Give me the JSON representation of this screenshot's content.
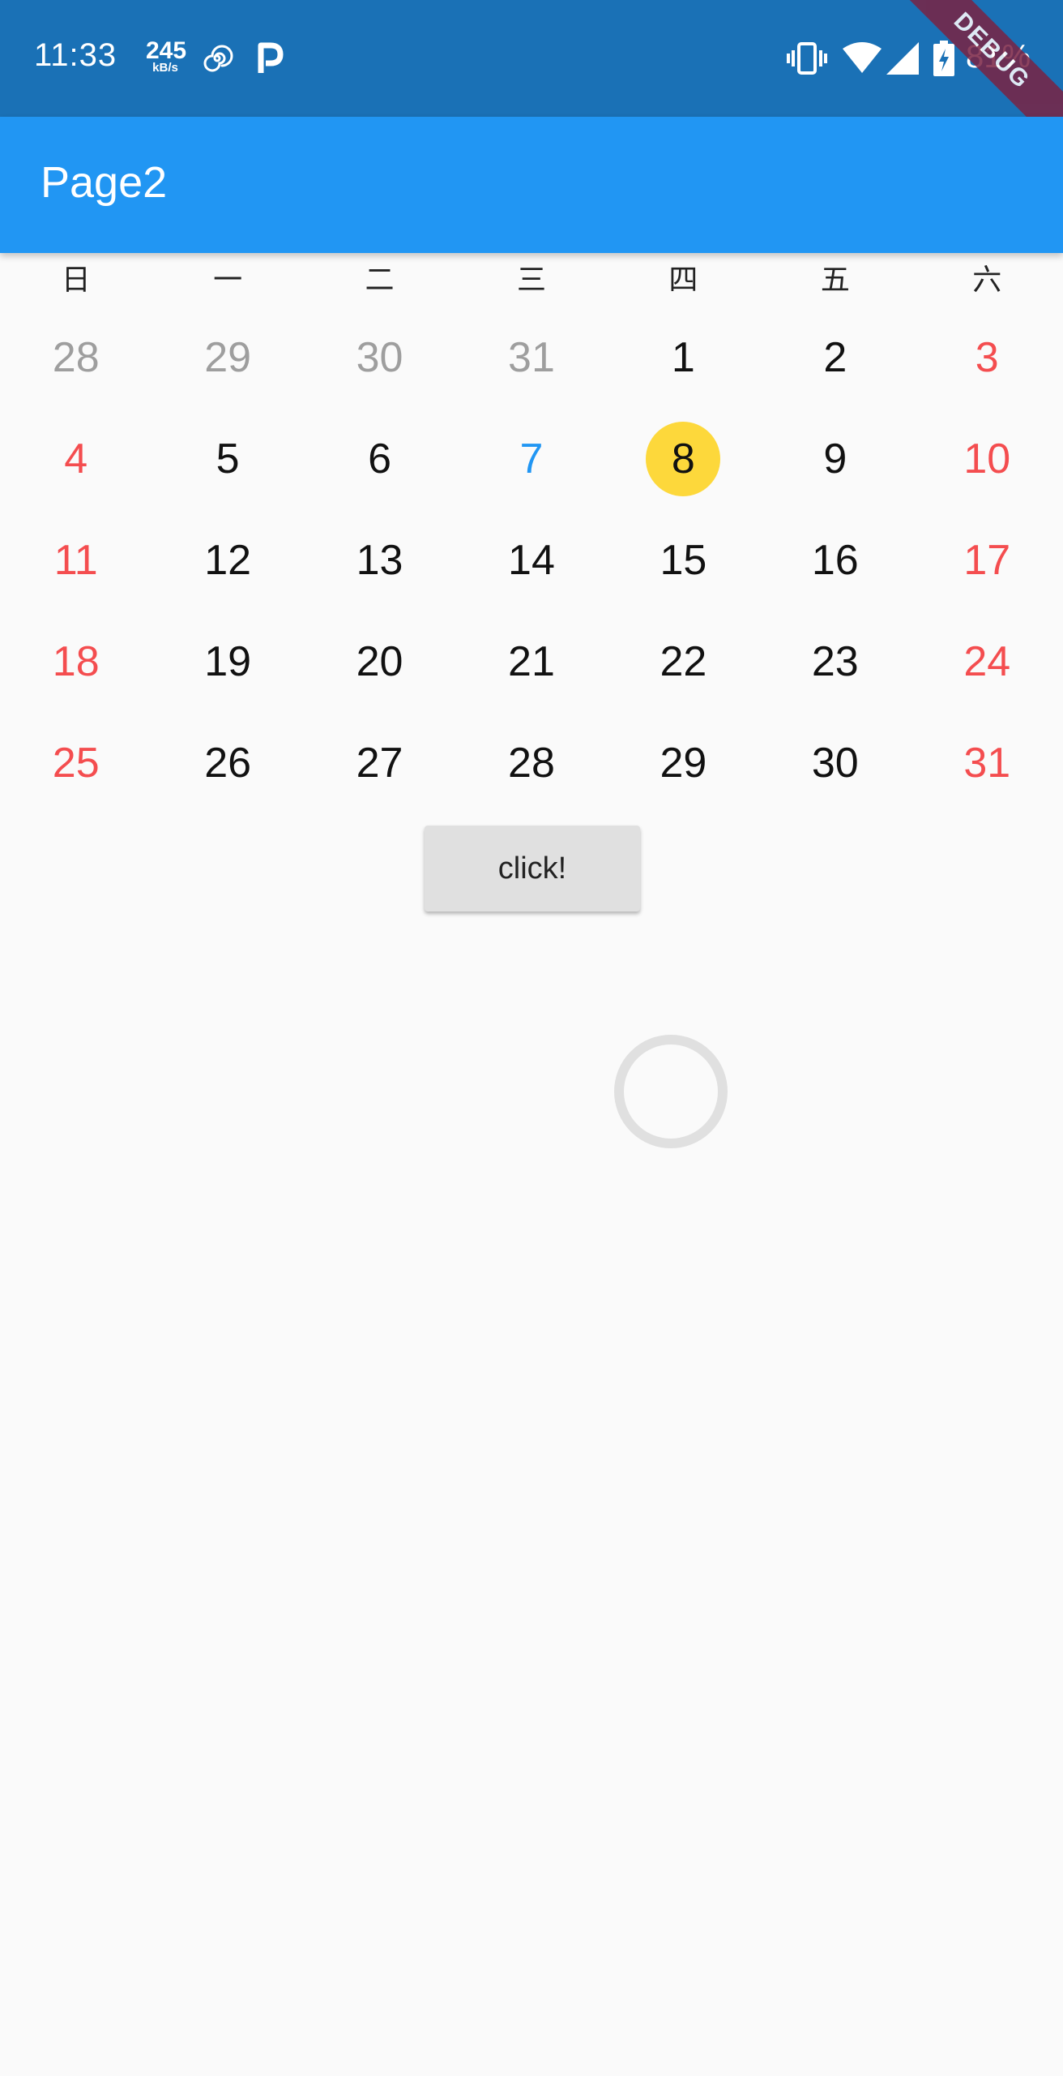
{
  "status_bar": {
    "time": "11:33",
    "net_speed": "245",
    "net_speed_unit": "kB/s",
    "battery_percent": "81%",
    "icons": [
      "spiral-icon",
      "p-app-icon",
      "vibrate-icon",
      "wifi-icon",
      "cell-signal-icon",
      "battery-charging-icon"
    ]
  },
  "debug_banner": "DEBUG",
  "app_bar": {
    "title": "Page2",
    "color": "#2196f3"
  },
  "calendar": {
    "weekdays": [
      "日",
      "一",
      "二",
      "三",
      "四",
      "五",
      "六"
    ],
    "weeks": [
      [
        "28",
        "29",
        "30",
        "31",
        "1",
        "2",
        "3"
      ],
      [
        "4",
        "5",
        "6",
        "7",
        "8",
        "9",
        "10"
      ],
      [
        "11",
        "12",
        "13",
        "14",
        "15",
        "16",
        "17"
      ],
      [
        "18",
        "19",
        "20",
        "21",
        "22",
        "23",
        "24"
      ],
      [
        "25",
        "26",
        "27",
        "28",
        "29",
        "30",
        "31"
      ]
    ],
    "today": "7",
    "selected": "8",
    "colors": {
      "weekend": "#f44d4f",
      "other_month": "#9e9e9e",
      "today": "#2196f3",
      "selected_bg": "#fdd83b"
    }
  },
  "button": {
    "label": "click!"
  },
  "progress": {
    "state": "loading"
  }
}
